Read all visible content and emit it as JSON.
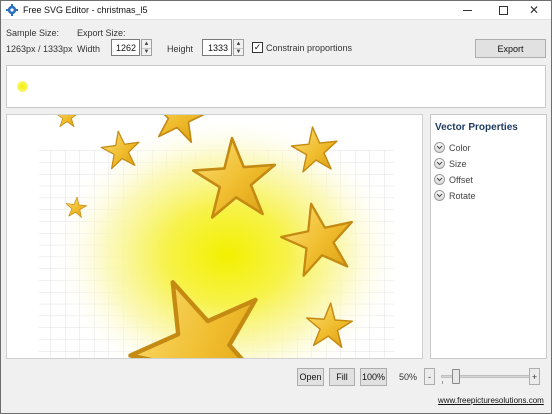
{
  "window": {
    "title": "Free SVG Editor - christmas_l5",
    "minimize_glyph": "—",
    "close_glyph": "✕"
  },
  "sample": {
    "label": "Sample Size:",
    "value": "1263px / 1333px"
  },
  "export_size": {
    "label": "Export Size:",
    "width_label": "Width",
    "width_value": "1262",
    "height_label": "Height",
    "height_value": "1333",
    "spin_up": "▲",
    "spin_down": "▼"
  },
  "constrain": {
    "label": "Constrain proportions",
    "checked": true,
    "check_glyph": "✓"
  },
  "export_button": "Export",
  "vector_properties": {
    "title": "Vector Properties",
    "expander_glyph": "⌄",
    "items": [
      "Color",
      "Size",
      "Offset",
      "Rotate"
    ]
  },
  "bottom_bar": {
    "open": "Open",
    "fill": "Fill",
    "actual": "100%",
    "zoom_text": "50%",
    "zoom_fraction": 0.15,
    "minus": "-",
    "plus": "+",
    "link": "www.freepicturesolutions.com"
  },
  "colors": {
    "star_fill": "#f2c43a",
    "star_edge": "#c48a12",
    "glow": "#f3f000",
    "grid": "#d9d9d9"
  }
}
